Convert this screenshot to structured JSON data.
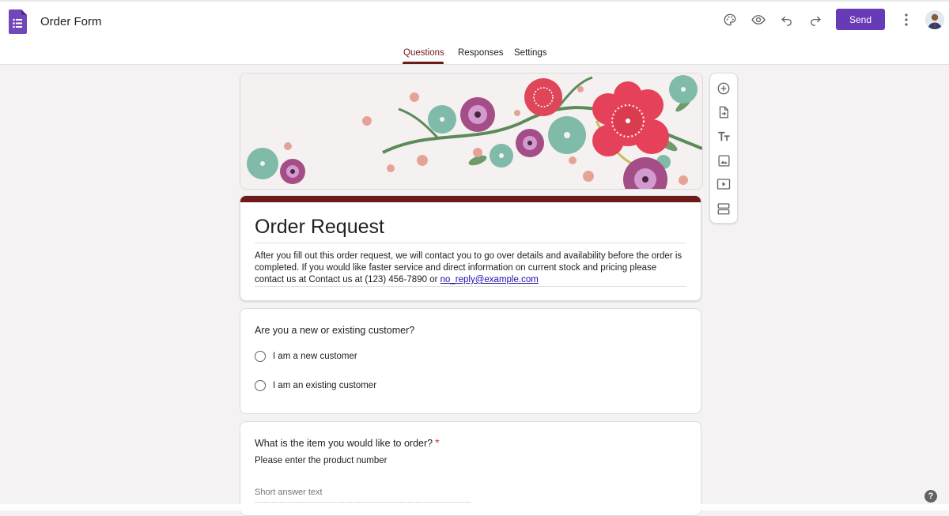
{
  "app": {
    "title": "Order Form"
  },
  "toolbar": {
    "send_label": "Send"
  },
  "tabs": [
    {
      "label": "Questions",
      "active": true
    },
    {
      "label": "Responses",
      "active": false
    },
    {
      "label": "Settings",
      "active": false
    }
  ],
  "form": {
    "title": "Order Request",
    "description": "After you fill out this order request, we will contact you to go over details and availability before the order is completed. If you would like faster service and direct information on current stock and pricing please contact us at Contact us at (123) 456-7890 or ",
    "email": "no_reply@example.com"
  },
  "questions": [
    {
      "title": "Are you a new or existing customer?",
      "options": [
        "I am a new customer",
        "I am an existing customer"
      ]
    },
    {
      "title": "What is the item you would like to order?",
      "required_mark": "*",
      "help": "Please enter the product number",
      "placeholder": "Short answer text"
    }
  ],
  "help": {
    "label": "?"
  },
  "colors": {
    "accent": "#6d1a1a",
    "brand": "#673ab7"
  },
  "icons": {
    "top": [
      "palette-icon",
      "preview-eye-icon",
      "undo-icon",
      "redo-icon",
      "more-vert-icon"
    ],
    "side": [
      "add-question-icon",
      "import-questions-icon",
      "add-title-icon",
      "add-image-icon",
      "add-video-icon",
      "add-section-icon"
    ]
  }
}
